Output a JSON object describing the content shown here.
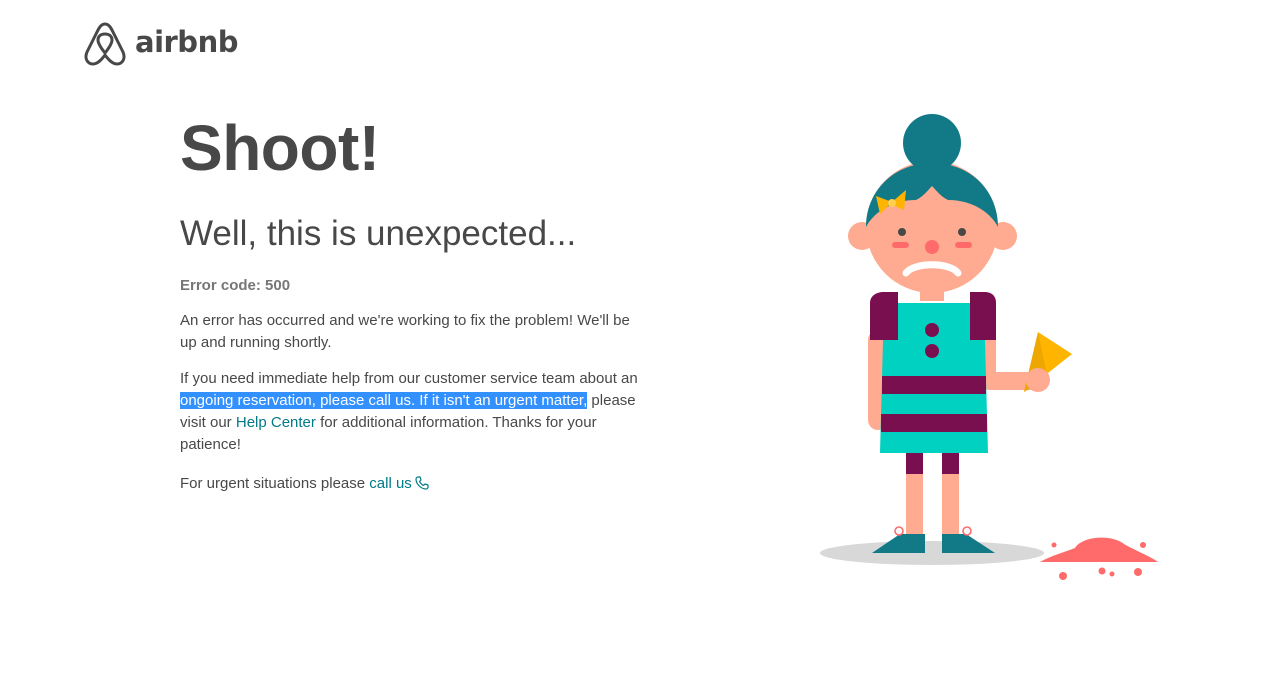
{
  "header": {
    "logo_text": "airbnb"
  },
  "main": {
    "title": "Shoot!",
    "subtitle": "Well, this is unexpected...",
    "error_code": "Error code: 500",
    "para1": "An error has occurred and we're working to fix the problem! We'll be up and running shortly.",
    "para2": {
      "before": "If you need immediate help from our customer service team about an",
      "highlighted": " ongoing reservation, please call us. If it isn't an urgent matter,",
      "mid": " please visit our ",
      "link": "Help Center",
      "after": " for additional information. Thanks for your patience!"
    },
    "para3": {
      "text": "For urgent situations please ",
      "link": "call us"
    }
  },
  "colors": {
    "link": "#007a87",
    "text": "#484848",
    "selection": "#3390ff",
    "logo": "#484848"
  },
  "icons": [
    "airbnb-logo-icon",
    "phone-icon",
    "crying-girl-illustration"
  ]
}
